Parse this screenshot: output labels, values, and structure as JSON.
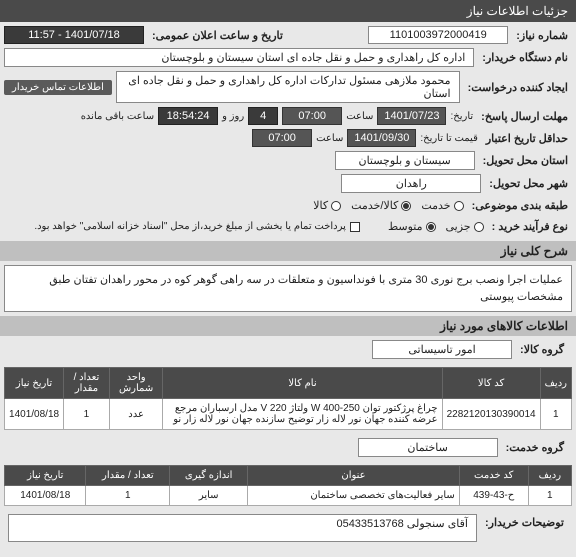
{
  "header": "جزئیات اطلاعات نیاز",
  "fields": {
    "need_number_label": "شماره نیاز:",
    "need_number": "1101003972000419",
    "announce_label": "تاریخ و ساعت اعلان عمومی:",
    "announce_value": "1401/07/18 - 11:57",
    "buyer_label": "نام دستگاه خریدار:",
    "buyer_value": "اداره کل راهداری و حمل و نقل جاده ای استان سیستان و بلوچستان",
    "creator_label": "ایجاد کننده درخواست:",
    "creator_value": "محمود ملازهی مسئول تدارکات اداره کل راهداری و حمل و نقل جاده ای استان",
    "contact_pill": "اطلاعات تماس خریدار",
    "deadline_label": "مهلت ارسال پاسخ:",
    "deadline_label2": "تاریخ:",
    "deadline_date": "1401/07/23",
    "time_label": "ساعت",
    "deadline_time": "07:00",
    "remaining_days": "4",
    "day_and": "روز و",
    "remaining_time": "18:54:24",
    "remaining_label": "ساعت باقی مانده",
    "validity_label": "حداقل تاریخ اعتبار",
    "validity_label2": "قیمت تا تاریخ:",
    "validity_date": "1401/09/30",
    "validity_time": "07:00",
    "province_label": "استان محل تحویل:",
    "province_value": "سیستان و بلوچستان",
    "city_label": "شهر محل تحویل:",
    "city_value": "راهدان",
    "category_label": "طبقه بندی موضوعی:",
    "cat_service": "خدمت",
    "cat_goods_service": "کالا/خدمت",
    "cat_goods": "کالا",
    "purchase_type_label": "نوع فرآیند خرید :",
    "pt_small": "جزیی",
    "pt_medium": "متوسط",
    "payment_note": "پرداخت تمام یا بخشی از مبلغ خرید،از محل \"اسناد خزانه اسلامی\" خواهد بود.",
    "general_desc_label": "شرح کلی نیاز",
    "general_desc": "عملیات اجرا ونصب برج نوری 30 متری با فونداسیون و متعلقات در سه راهی گوهر کوه در محور راهدان تفتان طبق مشخصات پیوستی",
    "items_header": "اطلاعات کالاهای مورد نیاز",
    "goods_group_label": "گروه کالا:",
    "goods_group_value": "امور تاسیساتی",
    "service_group_label": "گروه خدمت:",
    "service_group_value": "ساختمان",
    "notes_label": "توضیحات خریدار:",
    "notes_value": "آقای سنجولی 05433513768"
  },
  "goods_table": {
    "headers": [
      "ردیف",
      "کد کالا",
      "نام کالا",
      "واحد شمارش",
      "تعداد / مقدار",
      "تاریخ نیاز"
    ],
    "rows": [
      {
        "idx": "1",
        "code": "2282120130390014",
        "name": "چراغ پرژکتور توان W 400-250 ولتاژ V 220 مدل ارسباران مرجع عرضه کننده جهان نور لاله زار توضیح سازنده جهان نور لاله زار نو",
        "unit": "عدد",
        "qty": "1",
        "date": "1401/08/18"
      }
    ]
  },
  "service_table": {
    "headers": [
      "ردیف",
      "کد خدمت",
      "عنوان",
      "اندازه گیری",
      "تعداد / مقدار",
      "تاریخ نیاز"
    ],
    "rows": [
      {
        "idx": "1",
        "code": "ح-43-439",
        "title": "سایر فعالیت‌های تخصصی ساختمان",
        "measure": "سایر",
        "qty": "1",
        "date": "1401/08/18"
      }
    ]
  }
}
